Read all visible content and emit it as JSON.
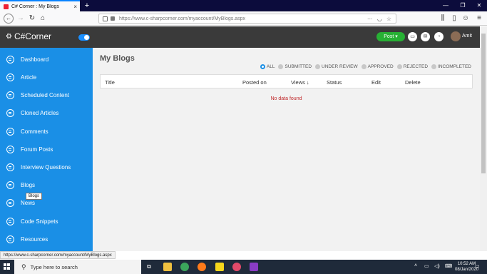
{
  "browser": {
    "tab_title": "C# Corner : My Blogs",
    "tab_close": "×",
    "new_tab": "+",
    "url": "https://www.c-sharpcorner.com/myaccount/MyBlogs.aspx",
    "window_controls": [
      "—",
      "❐",
      "✕"
    ]
  },
  "header": {
    "logo_text": "C#Corner",
    "post_label": "Post ▾",
    "user_name": "Amit",
    "icons": [
      "chat-icon",
      "mail-icon",
      "bell-icon"
    ]
  },
  "sidebar": {
    "items": [
      {
        "label": "Dashboard",
        "icon": "dashboard-icon"
      },
      {
        "label": "Article",
        "icon": "article-icon"
      },
      {
        "label": "Scheduled Content",
        "icon": "calendar-icon"
      },
      {
        "label": "Cloned Articles",
        "icon": "clone-icon"
      },
      {
        "label": "Comments",
        "icon": "comment-icon"
      },
      {
        "label": "Forum Posts",
        "icon": "forum-icon"
      },
      {
        "label": "Interview Questions",
        "icon": "question-icon"
      },
      {
        "label": "Blogs",
        "icon": "blog-icon"
      },
      {
        "label": "News",
        "icon": "news-icon"
      },
      {
        "label": "Code Snippets",
        "icon": "code-icon"
      },
      {
        "label": "Resources",
        "icon": "resources-icon"
      }
    ],
    "tooltip": "Blogs"
  },
  "main": {
    "title": "My Blogs",
    "filters": [
      "ALL",
      "SUBMITTED",
      "UNDER REVIEW",
      "APPROVED",
      "REJECTED",
      "INCOMPLETED"
    ],
    "selected_filter": "ALL",
    "columns": [
      "Title",
      "Posted on",
      "Views ↓",
      "Status",
      "Edit",
      "Delete"
    ],
    "empty_message": "No data found"
  },
  "status_url": "https://www.c-sharpcorner.com/myaccount/MyBlogs.aspx",
  "taskbar": {
    "search_placeholder": "Type here to search",
    "time": "10:52 AM",
    "date": "08/Jan/2020"
  },
  "colors": {
    "sidebar": "#1a8fe6",
    "header": "#3a3a3a",
    "post_button": "#27b034",
    "empty_message": "#c0282a"
  }
}
